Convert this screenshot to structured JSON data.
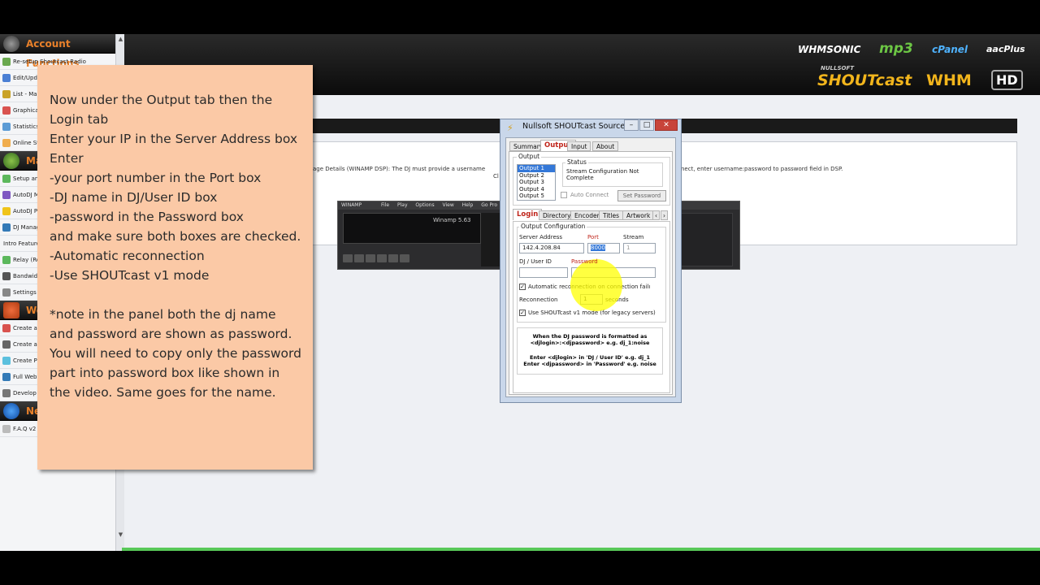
{
  "sidebar": {
    "section1": "Account Functions",
    "items1": [
      "Re-setup Shoutcast Radio",
      "Edit/Upda",
      "List - Man",
      "Graphica",
      "Statistics",
      "Online St"
    ],
    "section2": "Ma",
    "items2": [
      "Setup an",
      "AutoDJ M",
      "AutoDJ P",
      "DJ Manag",
      "Intro Feature",
      "Relay (Re",
      "Bandwid",
      "Settings"
    ],
    "section3": "We",
    "items3": [
      "Create a",
      "Create a",
      "Create Pl",
      "Full Web",
      "Develop"
    ],
    "section4": "Ne",
    "items4": [
      "F.A.Q v2"
    ]
  },
  "banner": {
    "logos": [
      "WHMSONIC",
      "mp3",
      "cPanel",
      "aacPlus",
      "NULLSOFT",
      "SHOUTcast",
      "WHM",
      "HD"
    ]
  },
  "panel": {
    "text_left": "age Details (WINAMP DSP): The DJ must provide a username",
    "text_cut": "Cl",
    "text_right": "nect, enter username:password to password field in DSP."
  },
  "winamp": {
    "title": "WINAMP",
    "menu": [
      "File",
      "Play",
      "Options",
      "View",
      "Help",
      "Go Pro"
    ],
    "version": "Winamp 5.63"
  },
  "note": {
    "para1": "Now under the Output tab then the Login tab\nEnter your IP in the Server Address box\nEnter\n-your port number in the Port box\n-DJ name in DJ/User ID box\n-password in the Password box\nand make sure both boxes are checked.\n-Automatic reconnection\n-Use SHOUTcast v1 mode",
    "para2": "*note in the panel both the dj name and password are shown as password. You will need to copy only the password part into password box like shown in the video. Same goes for the name."
  },
  "shoutcast": {
    "title": "Nullsoft SHOUTcast Source",
    "window_buttons": [
      "–",
      "□",
      "✕"
    ],
    "tabs": [
      "Summary",
      "Output",
      "Input",
      "About"
    ],
    "output_group": "Output",
    "outputs": [
      "Output 1",
      "Output 2",
      "Output 3",
      "Output 4",
      "Output 5"
    ],
    "status_label": "Status",
    "status_text": "Stream Configuration Not Complete",
    "auto_connect": "Auto Connect",
    "set_password": "Set Password",
    "subtabs": [
      "Login",
      "Directory",
      "Encoder",
      "Titles",
      "Artwork"
    ],
    "config_group": "Output Configuration",
    "server_address_label": "Server Address",
    "server_address": "142.4.208.84",
    "port_label": "Port",
    "port_value": "8000",
    "stream_label": "Stream",
    "stream_value": "1",
    "dj_label": "DJ / User ID",
    "password_label": "Password",
    "auto_reconnect": "Automatic reconnection on connection failu",
    "reconnection_label": "Reconnection",
    "reconnection_value": "1",
    "seconds": "seconds",
    "v1_mode": "Use SHOUTcast v1 mode (for legacy servers)",
    "info1": "When the DJ password is formatted as",
    "info2": "<djlogin>:<djpassword> e.g. dj_1:noise",
    "info3": "Enter <djlogin> in 'DJ / User ID' e.g. dj_1",
    "info4": "Enter <djpassword> in 'Password' e.g. noise"
  },
  "colors": {
    "note_bg": "#fbc9a6",
    "accent_red": "#c0261c",
    "highlight": "#ffff00"
  }
}
